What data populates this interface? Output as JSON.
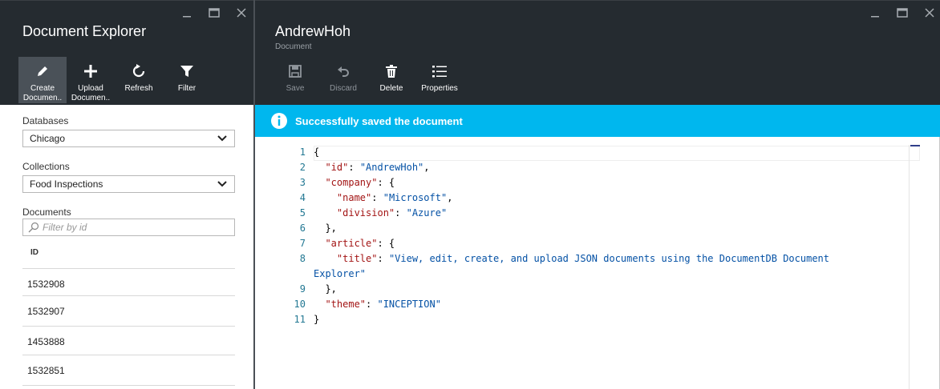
{
  "left_blade": {
    "title": "Document Explorer",
    "commands": [
      {
        "label": "Create Documen..",
        "icon": "pencil-icon"
      },
      {
        "label": "Upload Documen..",
        "icon": "plus-icon"
      },
      {
        "label": "Refresh",
        "icon": "refresh-icon"
      },
      {
        "label": "Filter",
        "icon": "filter-icon"
      }
    ],
    "databases_label": "Databases",
    "databases_value": "Chicago",
    "collections_label": "Collections",
    "collections_value": "Food Inspections",
    "documents_label": "Documents",
    "filter_placeholder": "Filter by id",
    "id_header": "ID",
    "documents": [
      "1532908",
      "1532907",
      "1453888",
      "1532851"
    ]
  },
  "right_blade": {
    "title": "AndrewHoh",
    "subtitle": "Document",
    "commands": [
      {
        "label": "Save",
        "icon": "save-icon",
        "enabled": false
      },
      {
        "label": "Discard",
        "icon": "undo-icon",
        "enabled": false
      },
      {
        "label": "Delete",
        "icon": "trash-icon",
        "enabled": true
      },
      {
        "label": "Properties",
        "icon": "list-icon",
        "enabled": true
      }
    ],
    "banner": "Successfully saved the document",
    "editor": {
      "line_numbers": [
        "1",
        "2",
        "3",
        "4",
        "5",
        "6",
        "7",
        "8",
        "",
        "9",
        "10",
        "11"
      ],
      "lines": [
        [
          {
            "t": "p",
            "v": "{"
          }
        ],
        [
          {
            "t": "p",
            "v": "  "
          },
          {
            "t": "k",
            "v": "\"id\""
          },
          {
            "t": "p",
            "v": ": "
          },
          {
            "t": "s",
            "v": "\"AndrewHoh\""
          },
          {
            "t": "p",
            "v": ","
          }
        ],
        [
          {
            "t": "p",
            "v": "  "
          },
          {
            "t": "k",
            "v": "\"company\""
          },
          {
            "t": "p",
            "v": ": {"
          }
        ],
        [
          {
            "t": "p",
            "v": "    "
          },
          {
            "t": "k",
            "v": "\"name\""
          },
          {
            "t": "p",
            "v": ": "
          },
          {
            "t": "s",
            "v": "\"Microsoft\""
          },
          {
            "t": "p",
            "v": ","
          }
        ],
        [
          {
            "t": "p",
            "v": "    "
          },
          {
            "t": "k",
            "v": "\"division\""
          },
          {
            "t": "p",
            "v": ": "
          },
          {
            "t": "s",
            "v": "\"Azure\""
          }
        ],
        [
          {
            "t": "p",
            "v": "  },"
          }
        ],
        [
          {
            "t": "p",
            "v": "  "
          },
          {
            "t": "k",
            "v": "\"article\""
          },
          {
            "t": "p",
            "v": ": {"
          }
        ],
        [
          {
            "t": "p",
            "v": "    "
          },
          {
            "t": "k",
            "v": "\"title\""
          },
          {
            "t": "p",
            "v": ": "
          },
          {
            "t": "s",
            "v": "\"View, edit, create, and upload JSON documents using the DocumentDB Document"
          }
        ],
        [
          {
            "t": "s",
            "v": "Explorer\""
          }
        ],
        [
          {
            "t": "p",
            "v": "  },"
          }
        ],
        [
          {
            "t": "p",
            "v": "  "
          },
          {
            "t": "k",
            "v": "\"theme\""
          },
          {
            "t": "p",
            "v": ": "
          },
          {
            "t": "s",
            "v": "\"INCEPTION\""
          }
        ],
        [
          {
            "t": "p",
            "v": "}"
          }
        ]
      ]
    }
  },
  "window_controls": {
    "minimize": "—",
    "maximize": "□",
    "close": "✕"
  },
  "colors": {
    "banner": "#00b7ee",
    "header": "#252b30",
    "key": "#a31515",
    "string": "#0451a5",
    "gutter": "#237893"
  }
}
